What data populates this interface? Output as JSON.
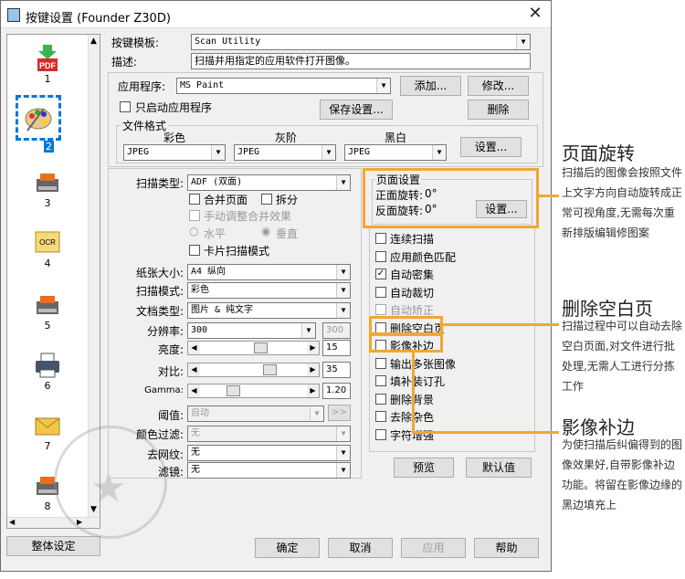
{
  "window": {
    "title": "按键设置 (Founder Z30D)",
    "close_icon": "✕"
  },
  "sidebar": {
    "items": [
      {
        "label": "1",
        "icon": "pdf-icon"
      },
      {
        "label": "2",
        "icon": "paint-palette-icon"
      },
      {
        "label": "3",
        "icon": "scan-app-icon"
      },
      {
        "label": "4",
        "icon": "ocr-icon"
      },
      {
        "label": "5",
        "icon": "scan-app-icon"
      },
      {
        "label": "6",
        "icon": "printer-icon"
      },
      {
        "label": "7",
        "icon": "email-icon"
      },
      {
        "label": "8",
        "icon": "scan-app-icon"
      }
    ],
    "pdf_text": "PDF",
    "ocr_text": "OCR",
    "selected_index": 2,
    "overall_button": "整体设定"
  },
  "template": {
    "label": "按键模板:",
    "value": "Scan Utility"
  },
  "desc": {
    "label": "描述:",
    "value": "扫描并用指定的应用软件打开图像。"
  },
  "app": {
    "label": "应用程序:",
    "value": "MS Paint",
    "add_button": "添加...",
    "edit_button": "修改...",
    "only_app_label": "只启动应用程序",
    "save_button": "保存设置...",
    "delete_button": "删除"
  },
  "file_format": {
    "legend": "文件格式",
    "color_label": "彩色",
    "gray_label": "灰阶",
    "bw_label": "黑白",
    "color_value": "JPEG",
    "gray_value": "JPEG",
    "bw_value": "JPEG",
    "settings_button": "设置..."
  },
  "scan": {
    "type_label": "扫描类型:",
    "type_value": "ADF (双面)",
    "merge_label": "合并页面",
    "split_label": "拆分",
    "manual_merge_label": "手动调整合并效果",
    "horizontal_label": "水平",
    "vertical_label": "垂直",
    "card_label": "卡片扫描模式"
  },
  "fields": {
    "paper_label": "纸张大小:",
    "paper_value": "A4 纵向",
    "mode_label": "扫描模式:",
    "mode_value": "彩色",
    "doc_label": "文档类型:",
    "doc_value": "图片 & 纯文字",
    "res_label": "分辨率:",
    "res_value": "300",
    "res_value2": "300",
    "bright_label": "亮度:",
    "bright_value": "15",
    "contrast_label": "对比:",
    "contrast_value": "35",
    "gamma_label": "Gamma:",
    "gamma_value": "1.20",
    "threshold_label": "阈值:",
    "threshold_value": "自动",
    "threshold_btn": ">>",
    "color_filter_label": "颜色过滤:",
    "color_filter_value": "无",
    "descreen_label": "去网纹:",
    "descreen_value": "无",
    "filter_label": "滤镜:",
    "filter_value": "无"
  },
  "page_setup": {
    "legend": "页面设置",
    "front_label": "正面旋转:",
    "front_value": "0°",
    "back_label": "反面旋转:",
    "back_value": "0°",
    "settings_button": "设置..."
  },
  "options": [
    {
      "label": "连续扫描",
      "checked": false,
      "enabled": true
    },
    {
      "label": "应用颜色匹配",
      "checked": false,
      "enabled": true
    },
    {
      "label": "自动密集",
      "checked": true,
      "enabled": true
    },
    {
      "label": "自动裁切",
      "checked": false,
      "enabled": true
    },
    {
      "label": "自动矫正",
      "checked": false,
      "enabled": false
    },
    {
      "label": "删除空白页",
      "checked": false,
      "enabled": true
    },
    {
      "label": "影像补边",
      "checked": false,
      "enabled": true
    },
    {
      "label": "输出多张图像",
      "checked": false,
      "enabled": true
    },
    {
      "label": "填补装订孔",
      "checked": false,
      "enabled": true
    },
    {
      "label": "删除背景",
      "checked": false,
      "enabled": true
    },
    {
      "label": "去除杂色",
      "checked": false,
      "enabled": true
    },
    {
      "label": "字符增强",
      "checked": false,
      "enabled": true
    }
  ],
  "buttons": {
    "preview": "预览",
    "default": "默认值",
    "ok": "确定",
    "cancel": "取消",
    "apply": "应用",
    "help": "帮助"
  },
  "annotations": [
    {
      "heading": "页面旋转",
      "text": "扫描后的图像会按照文件上文字方向自动旋转成正常可视角度,无需每次重新排版编辑修图案"
    },
    {
      "heading": "删除空白页",
      "text": "扫描过程中可以自动去除空白页面,对文件进行批处理,无需人工进行分拣工作"
    },
    {
      "heading": "影像补边",
      "text": "为使扫描后纠偏得到的图像效果好,自带影像补边功能。将留在影像边缘的黑边填充上"
    }
  ],
  "colors": {
    "highlight": "#f0a830",
    "selection": "#0078d7",
    "pdf_red": "#d92b2b"
  }
}
